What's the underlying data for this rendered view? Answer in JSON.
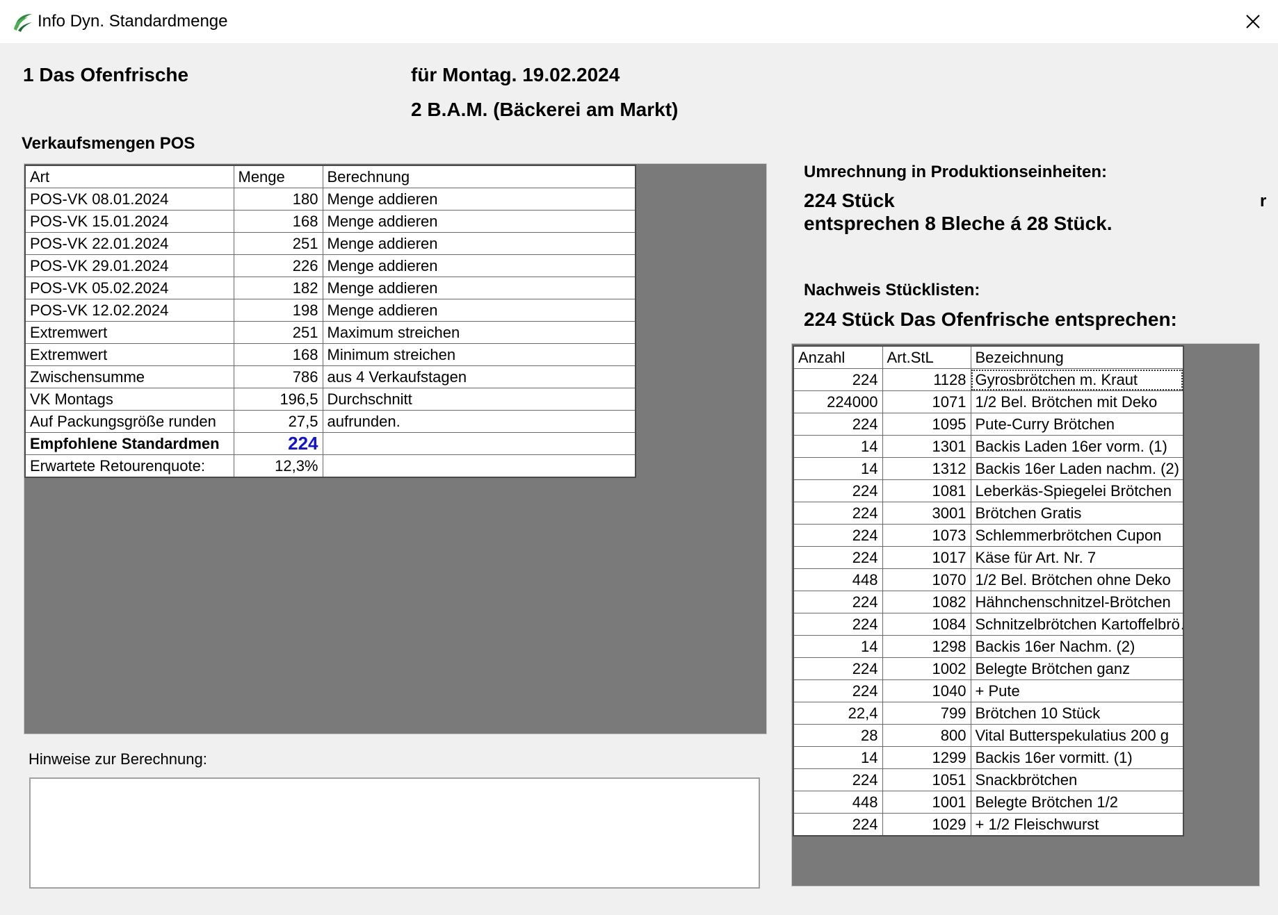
{
  "window": {
    "title": "Info Dyn. Standardmenge",
    "close_symbol": "✕"
  },
  "header": {
    "store": "1 Das Ofenfrische",
    "date": "für Montag. 19.02.2024",
    "branch": "2 B.A.M. (Bäckerei am Markt)",
    "section_title": "Verkaufsmengen POS"
  },
  "pos_table": {
    "columns": [
      "Art",
      "Menge",
      "Berechnung"
    ],
    "rows": [
      {
        "art": "POS-VK 08.01.2024",
        "menge": "180",
        "berechnung": "Menge addieren"
      },
      {
        "art": "POS-VK 15.01.2024",
        "menge": "168",
        "berechnung": "Menge addieren"
      },
      {
        "art": "POS-VK 22.01.2024",
        "menge": "251",
        "berechnung": "Menge addieren"
      },
      {
        "art": "POS-VK 29.01.2024",
        "menge": "226",
        "berechnung": "Menge addieren"
      },
      {
        "art": "POS-VK 05.02.2024",
        "menge": "182",
        "berechnung": "Menge addieren"
      },
      {
        "art": "POS-VK 12.02.2024",
        "menge": "198",
        "berechnung": "Menge addieren"
      },
      {
        "art": "Extremwert",
        "menge": "251",
        "berechnung": "Maximum streichen"
      },
      {
        "art": "Extremwert",
        "menge": "168",
        "berechnung": "Minimum streichen"
      },
      {
        "art": "Zwischensumme",
        "menge": "786",
        "berechnung": "aus 4 Verkaufstagen"
      },
      {
        "art": "VK Montags",
        "menge": "196,5",
        "berechnung": "Durchschnitt"
      },
      {
        "art": "Auf Packungsgröße runden",
        "menge": "27,5",
        "berechnung": "aufrunden."
      },
      {
        "art": "Empfohlene Standardmen",
        "menge": "224",
        "berechnung": ""
      },
      {
        "art": "Erwartete Retourenquote:",
        "menge": "12,3%",
        "berechnung": ""
      }
    ]
  },
  "umrechnung": {
    "title": "Umrechnung in Produktionseinheiten:",
    "line1": "224 Stück",
    "line2": "entsprechen 8 Bleche  á 28 Stück.",
    "clipped_fragment": "r"
  },
  "nachweis": {
    "title": "Nachweis Stücklisten:",
    "subtitle": "224 Stück Das Ofenfrische entsprechen:"
  },
  "bom_table": {
    "columns": [
      "Anzahl",
      "Art.StL",
      "Bezeichnung"
    ],
    "rows": [
      {
        "anzahl": "224",
        "artstl": "1128",
        "bez": "Gyrosbrötchen m. Kraut"
      },
      {
        "anzahl": "224000",
        "artstl": "1071",
        "bez": "1/2 Bel. Brötchen mit Deko"
      },
      {
        "anzahl": "224",
        "artstl": "1095",
        "bez": "Pute-Curry Brötchen"
      },
      {
        "anzahl": "14",
        "artstl": "1301",
        "bez": "Backis Laden 16er vorm. (1)"
      },
      {
        "anzahl": "14",
        "artstl": "1312",
        "bez": "Backis 16er Laden  nachm. (2)"
      },
      {
        "anzahl": "224",
        "artstl": "1081",
        "bez": "Leberkäs-Spiegelei Brötchen"
      },
      {
        "anzahl": "224",
        "artstl": "3001",
        "bez": "Brötchen Gratis"
      },
      {
        "anzahl": "224",
        "artstl": "1073",
        "bez": "Schlemmerbrötchen  Cupon"
      },
      {
        "anzahl": "224",
        "artstl": "1017",
        "bez": "Käse für Art. Nr. 7"
      },
      {
        "anzahl": "448",
        "artstl": "1070",
        "bez": "1/2 Bel. Brötchen ohne Deko"
      },
      {
        "anzahl": "224",
        "artstl": "1082",
        "bez": "Hähnchenschnitzel-Brötchen"
      },
      {
        "anzahl": "224",
        "artstl": "1084",
        "bez": "Schnitzelbrötchen Kartoffelbrö…"
      },
      {
        "anzahl": "14",
        "artstl": "1298",
        "bez": "Backis 16er Nachm. (2)"
      },
      {
        "anzahl": "224",
        "artstl": "1002",
        "bez": "Belegte Brötchen ganz"
      },
      {
        "anzahl": "224",
        "artstl": "1040",
        "bez": "+ Pute"
      },
      {
        "anzahl": "22,4",
        "artstl": "799",
        "bez": "Brötchen 10 Stück"
      },
      {
        "anzahl": "28",
        "artstl": "800",
        "bez": "Vital Butterspekulatius 200 g"
      },
      {
        "anzahl": "14",
        "artstl": "1299",
        "bez": "Backis 16er vormitt. (1)"
      },
      {
        "anzahl": "224",
        "artstl": "1051",
        "bez": "Snackbrötchen"
      },
      {
        "anzahl": "448",
        "artstl": "1001",
        "bez": "Belegte Brötchen 1/2"
      },
      {
        "anzahl": "224",
        "artstl": "1029",
        "bez": "+ 1/2 Fleischwurst"
      }
    ]
  },
  "notes": {
    "label": "Hinweise zur Berechnung:",
    "value": ""
  },
  "colors": {
    "accent": "#1010e0",
    "panel_gray": "#7a7a7a",
    "window_bg": "#f0f0f0"
  }
}
